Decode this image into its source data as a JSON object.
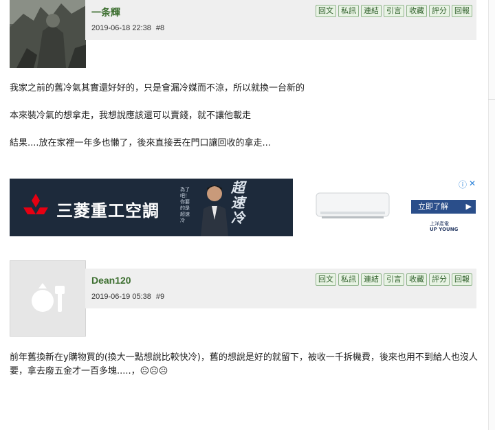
{
  "posts": [
    {
      "username": "一条輝",
      "timestamp": "2019-06-18 22:38",
      "floor": "#8",
      "actions": [
        "回文",
        "私訊",
        "連結",
        "引言",
        "收藏",
        "評分",
        "回報"
      ],
      "paragraphs": [
        "我家之前的舊冷氣其實還好好的，只是會漏冷媒而不涼，所以就換一台新的",
        "本來裝冷氣的想拿走，我想說應該還可以賣錢，就不讓他載走",
        "結果....放在家裡一年多也懶了，後來直接丟在門口讓回收的拿走..."
      ]
    },
    {
      "username": "Dean120",
      "timestamp": "2019-06-19 05:38",
      "floor": "#9",
      "actions": [
        "回文",
        "私訊",
        "連結",
        "引言",
        "收藏",
        "評分",
        "回報"
      ],
      "paragraphs": [
        "前年舊換新在y購物買的(換大一點想說比較快冷)，舊的想說是好的就留下，被收一千拆機費，後來也用不到給人也沒人要，拿去廢五金才一百多塊.....，☹☹☹"
      ]
    }
  ],
  "ad": {
    "brand": "三菱重工空調",
    "slogan_big": "超速冷",
    "slogan_small": "為了吧！你要的是超速冷",
    "cta": "立即了解",
    "cta_arrow": "▶",
    "logo_text": "上洋產電",
    "logo_name": "UP YOUNG",
    "info_icon": "ⓘ",
    "close_icon": "✕",
    "colors": {
      "banner_bg": "#1d2a3b",
      "brand_red": "#e60012",
      "cta_bg": "#2a4e8a"
    }
  },
  "colors": {
    "username": "#3c6e2f",
    "header_bg": "#efefef",
    "button_border": "#8fb38a"
  }
}
